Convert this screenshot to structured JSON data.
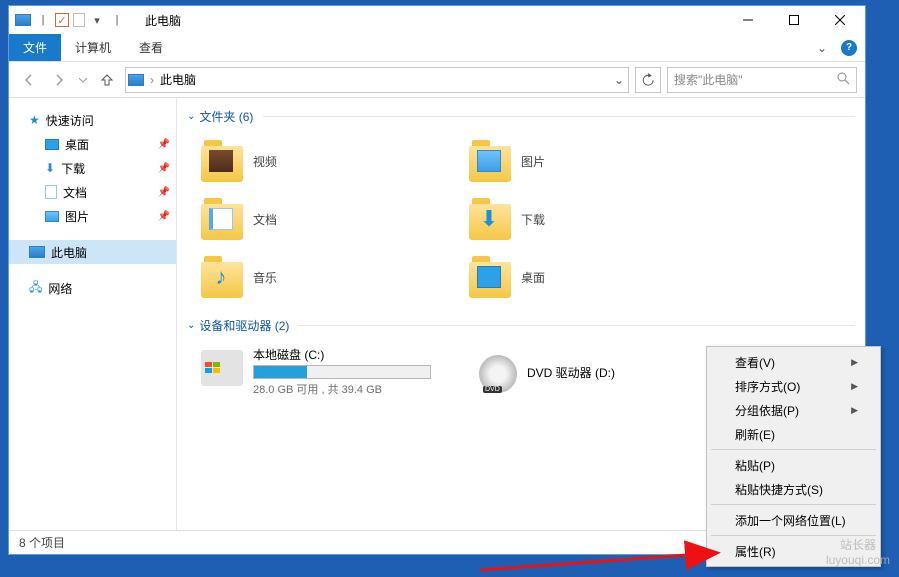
{
  "titlebar": {
    "title": "此电脑"
  },
  "ribbon": {
    "file": "文件",
    "computer": "计算机",
    "view": "查看"
  },
  "nav": {
    "address": "此电脑",
    "search_placeholder": "搜索\"此电脑\""
  },
  "sidebar": {
    "quick": "快速访问",
    "items": [
      "桌面",
      "下载",
      "文档",
      "图片"
    ],
    "thispc": "此电脑",
    "network": "网络"
  },
  "groups": {
    "folders_label": "文件夹 (6)",
    "devices_label": "设备和驱动器 (2)"
  },
  "folders": [
    {
      "name": "视频"
    },
    {
      "name": "图片"
    },
    {
      "name": "文档"
    },
    {
      "name": "下载"
    },
    {
      "name": "音乐"
    },
    {
      "name": "桌面"
    }
  ],
  "drives": [
    {
      "name": "本地磁盘 (C:)",
      "free": "28.0 GB 可用 ,  共 39.4 GB",
      "fill_pct": 30
    },
    {
      "name": "DVD 驱动器 (D:)"
    }
  ],
  "statusbar": {
    "count": "8 个项目"
  },
  "context": {
    "items": [
      {
        "label": "查看(V)",
        "sub": true
      },
      {
        "label": "排序方式(O)",
        "sub": true
      },
      {
        "label": "分组依据(P)",
        "sub": true
      },
      {
        "label": "刷新(E)"
      },
      {
        "sep": true
      },
      {
        "label": "粘贴(P)"
      },
      {
        "label": "粘贴快捷方式(S)"
      },
      {
        "sep": true
      },
      {
        "label": "添加一个网络位置(L)"
      },
      {
        "sep": true
      },
      {
        "label": "属性(R)"
      }
    ]
  },
  "watermark": {
    "line1": "站长器",
    "line2": "luyouqi.com"
  }
}
